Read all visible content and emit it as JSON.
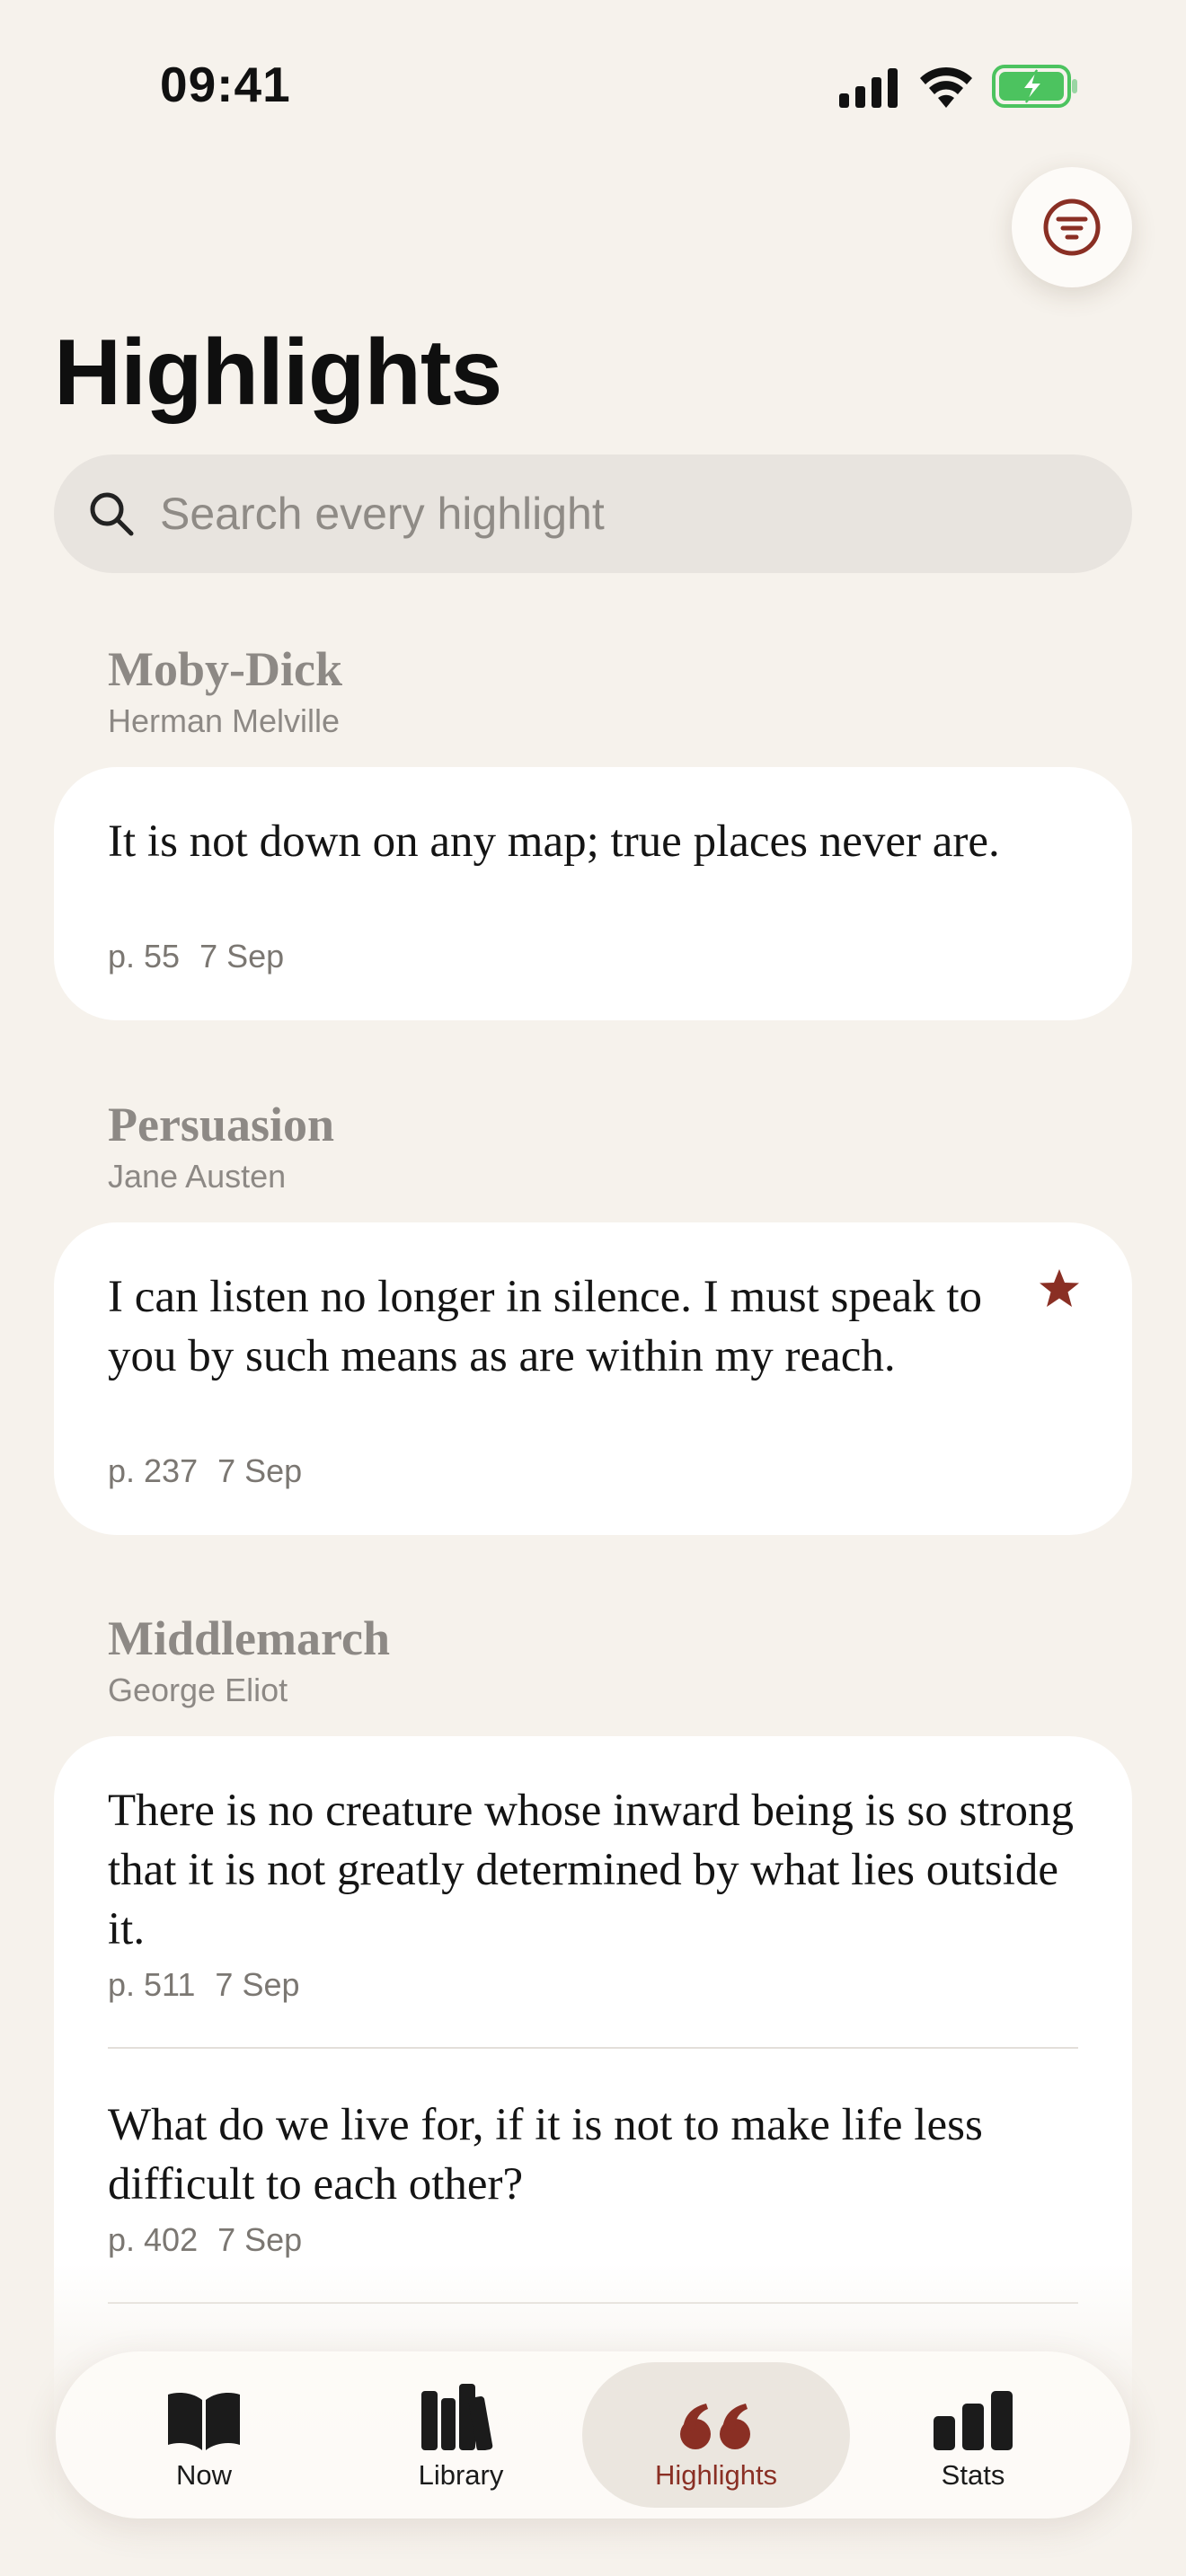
{
  "status_bar": {
    "time": "09:41"
  },
  "header": {
    "title": "Highlights"
  },
  "search": {
    "placeholder": "Search every highlight",
    "value": ""
  },
  "colors": {
    "accent": "#8a2f24",
    "background": "#f6f2ec",
    "card": "#ffffff"
  },
  "books": [
    {
      "title": "Moby-Dick",
      "author": "Herman Melville",
      "highlights": [
        {
          "text": "It is not down on any map; true places never are.",
          "page": "p. 55",
          "date": "7 Sep",
          "starred": false
        }
      ]
    },
    {
      "title": "Persuasion",
      "author": "Jane Austen",
      "highlights": [
        {
          "text": "I can listen no longer in silence. I must speak to you by such means as are within my reach.",
          "page": "p. 237",
          "date": "7 Sep",
          "starred": true
        }
      ]
    },
    {
      "title": "Middlemarch",
      "author": "George Eliot",
      "highlights": [
        {
          "text": "There is no creature whose inward being is so strong that it is not greatly determined by what lies outside it.",
          "page": "p. 511",
          "date": "7 Sep",
          "starred": false
        },
        {
          "text": "What do we live for, if it is not to make life less difficult to each other?",
          "page": "p. 402",
          "date": "7 Sep",
          "starred": false
        }
      ]
    }
  ],
  "tabs": [
    {
      "label": "Now",
      "icon": "open-book-icon",
      "active": false
    },
    {
      "label": "Library",
      "icon": "books-shelf-icon",
      "active": false
    },
    {
      "label": "Highlights",
      "icon": "quote-icon",
      "active": true
    },
    {
      "label": "Stats",
      "icon": "bar-chart-icon",
      "active": false
    }
  ]
}
